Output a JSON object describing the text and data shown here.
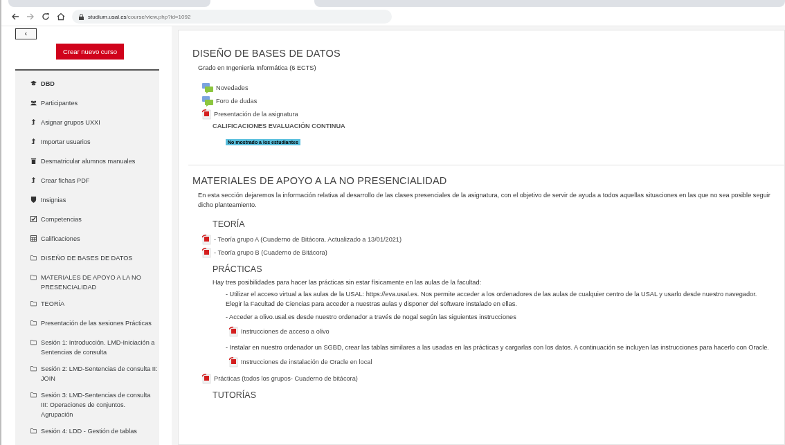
{
  "browser": {
    "url_host": "studium.usal.es",
    "url_path": "/course/view.php?id=1092"
  },
  "drawer_toggle": "‹",
  "create_button": "Crear nuevo curso",
  "sidebar": {
    "items": [
      {
        "kind": "course",
        "label": "DBD",
        "bold": true
      },
      {
        "kind": "users",
        "label": "Participantes",
        "bold": false
      },
      {
        "kind": "upload",
        "label": "Asignar grupos UXXI",
        "bold": false
      },
      {
        "kind": "upload",
        "label": "Importar usuarios",
        "bold": false
      },
      {
        "kind": "trash",
        "label": "Desmatricular alumnos manuales",
        "bold": false
      },
      {
        "kind": "upload",
        "label": "Crear fichas PDF",
        "bold": false
      },
      {
        "kind": "shield",
        "label": "Insignias",
        "bold": false
      },
      {
        "kind": "check",
        "label": "Competencias",
        "bold": false
      },
      {
        "kind": "table",
        "label": "Calificaciones",
        "bold": false
      },
      {
        "kind": "folder",
        "label": "DISEÑO DE BASES DE DATOS",
        "bold": false
      },
      {
        "kind": "folder",
        "label": "MATERIALES DE APOYO A LA NO PRESENCIALIDAD",
        "bold": false
      },
      {
        "kind": "folder",
        "label": "TEORÍA",
        "bold": false
      },
      {
        "kind": "folder",
        "label": "Presentación de las sesiones Prácticas",
        "bold": false
      },
      {
        "kind": "folder",
        "label": "Sesión 1: Introducción. LMD-Iniciación a Sentencias de consulta",
        "bold": false
      },
      {
        "kind": "folder",
        "label": "Sesión 2: LMD-Sentencias de consulta II: JOIN",
        "bold": false
      },
      {
        "kind": "folder",
        "label": "Sesión 3: LMD-Sentencias de consulta III: Operaciones de conjuntos. Agrupación",
        "bold": false
      },
      {
        "kind": "folder",
        "label": "Sesión 4: LDD - Gestión de tablas",
        "bold": false
      }
    ]
  },
  "sections": [
    {
      "title": "DISEÑO DE BASES DE DATOS",
      "blocks": [
        {
          "kind": "summary",
          "text": "Grado en Ingeniería Informática (6 ECTS)"
        },
        {
          "kind": "forum",
          "text": "Novedades"
        },
        {
          "kind": "forum",
          "text": "Foro de dudas"
        },
        {
          "kind": "pdf",
          "text": "Presentación de la asignatura"
        },
        {
          "kind": "label",
          "text": "CALIFICACIONES EVALUACIÓN CONTINUA"
        },
        {
          "kind": "badge",
          "text": "No mostrado a los estudiantes"
        }
      ]
    },
    {
      "title": "MATERIALES DE APOYO A LA NO PRESENCIALIDAD",
      "blocks": [
        {
          "kind": "summary",
          "text": "En esta sección dejaremos la información relativa al desarrollo de las clases presenciales de la asignatura, con el objetivo de servir de ayuda a todos aquellas situaciones en las que no sea posible seguir dicho planteamiento."
        },
        {
          "kind": "subheading",
          "text": "TEORÍA"
        },
        {
          "kind": "pdf",
          "text": "- Teoría grupo A (Cuaderno de Bitácora. Actualizado a 13/01/2021)"
        },
        {
          "kind": "pdf",
          "text": "- Teoría grupo B (Cuaderno de Bitácora)"
        },
        {
          "kind": "subheading",
          "text": "PRÁCTICAS"
        },
        {
          "kind": "text",
          "text": "Hay tres posibilidades para hacer las prácticas sin estar físicamente en las aulas de la facultad:"
        },
        {
          "kind": "option",
          "text": "- Utilizar el acceso virtual a las aulas de la USAL: https://eva.usal.es. Nos permite acceder a los ordenadores de las aulas de cualquier centro de la USAL y usarlo desde nuestro navegador. Elegir la Facultad de Ciencias para acceder a nuestras aulas y disponer del software instalado en ellas."
        },
        {
          "kind": "option",
          "text": "- Acceder a olivo.usal.es desde nuestro ordenador a través de nogal según las siguientes instrucciones",
          "children": [
            {
              "kind": "pdf",
              "text": "Instrucciones de acceso a olivo"
            }
          ]
        },
        {
          "kind": "option",
          "text": "- Instalar en nuestro ordenador un SGBD, crear las tablas similares a las usadas en las prácticas y cargarlas con los datos. A continuación se incluyen las instrucciones para hacerlo con Oracle.",
          "children": [
            {
              "kind": "pdf",
              "text": "Instrucciones de instalación de Oracle en local"
            }
          ]
        },
        {
          "kind": "pdf",
          "text": "Prácticas (todos los grupos- Cuaderno de bitácora)"
        },
        {
          "kind": "subheading",
          "text": "TUTORÍAS"
        }
      ]
    }
  ]
}
